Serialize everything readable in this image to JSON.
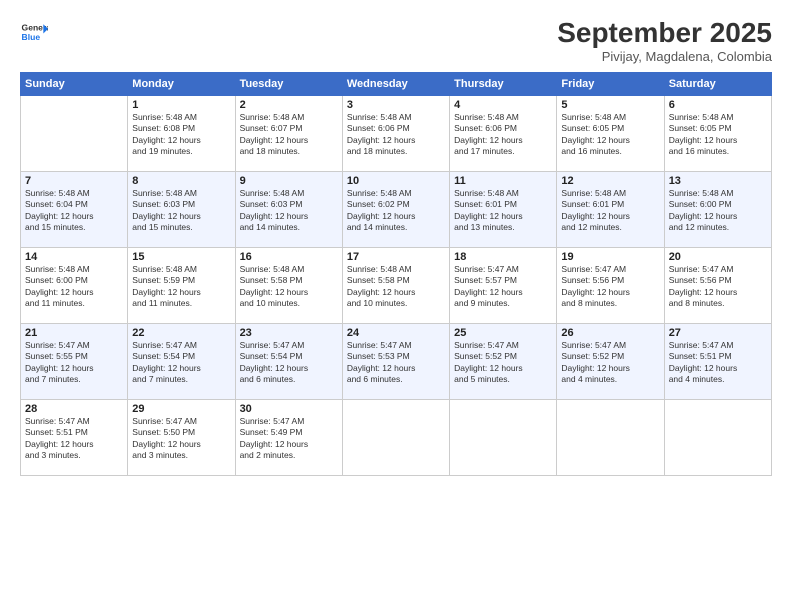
{
  "header": {
    "logo_line1": "General",
    "logo_line2": "Blue",
    "month": "September 2025",
    "location": "Pivijay, Magdalena, Colombia"
  },
  "days_of_week": [
    "Sunday",
    "Monday",
    "Tuesday",
    "Wednesday",
    "Thursday",
    "Friday",
    "Saturday"
  ],
  "weeks": [
    [
      {
        "day": "",
        "info": ""
      },
      {
        "day": "1",
        "info": "Sunrise: 5:48 AM\nSunset: 6:08 PM\nDaylight: 12 hours\nand 19 minutes."
      },
      {
        "day": "2",
        "info": "Sunrise: 5:48 AM\nSunset: 6:07 PM\nDaylight: 12 hours\nand 18 minutes."
      },
      {
        "day": "3",
        "info": "Sunrise: 5:48 AM\nSunset: 6:06 PM\nDaylight: 12 hours\nand 18 minutes."
      },
      {
        "day": "4",
        "info": "Sunrise: 5:48 AM\nSunset: 6:06 PM\nDaylight: 12 hours\nand 17 minutes."
      },
      {
        "day": "5",
        "info": "Sunrise: 5:48 AM\nSunset: 6:05 PM\nDaylight: 12 hours\nand 16 minutes."
      },
      {
        "day": "6",
        "info": "Sunrise: 5:48 AM\nSunset: 6:05 PM\nDaylight: 12 hours\nand 16 minutes."
      }
    ],
    [
      {
        "day": "7",
        "info": "Sunrise: 5:48 AM\nSunset: 6:04 PM\nDaylight: 12 hours\nand 15 minutes."
      },
      {
        "day": "8",
        "info": "Sunrise: 5:48 AM\nSunset: 6:03 PM\nDaylight: 12 hours\nand 15 minutes."
      },
      {
        "day": "9",
        "info": "Sunrise: 5:48 AM\nSunset: 6:03 PM\nDaylight: 12 hours\nand 14 minutes."
      },
      {
        "day": "10",
        "info": "Sunrise: 5:48 AM\nSunset: 6:02 PM\nDaylight: 12 hours\nand 14 minutes."
      },
      {
        "day": "11",
        "info": "Sunrise: 5:48 AM\nSunset: 6:01 PM\nDaylight: 12 hours\nand 13 minutes."
      },
      {
        "day": "12",
        "info": "Sunrise: 5:48 AM\nSunset: 6:01 PM\nDaylight: 12 hours\nand 12 minutes."
      },
      {
        "day": "13",
        "info": "Sunrise: 5:48 AM\nSunset: 6:00 PM\nDaylight: 12 hours\nand 12 minutes."
      }
    ],
    [
      {
        "day": "14",
        "info": "Sunrise: 5:48 AM\nSunset: 6:00 PM\nDaylight: 12 hours\nand 11 minutes."
      },
      {
        "day": "15",
        "info": "Sunrise: 5:48 AM\nSunset: 5:59 PM\nDaylight: 12 hours\nand 11 minutes."
      },
      {
        "day": "16",
        "info": "Sunrise: 5:48 AM\nSunset: 5:58 PM\nDaylight: 12 hours\nand 10 minutes."
      },
      {
        "day": "17",
        "info": "Sunrise: 5:48 AM\nSunset: 5:58 PM\nDaylight: 12 hours\nand 10 minutes."
      },
      {
        "day": "18",
        "info": "Sunrise: 5:47 AM\nSunset: 5:57 PM\nDaylight: 12 hours\nand 9 minutes."
      },
      {
        "day": "19",
        "info": "Sunrise: 5:47 AM\nSunset: 5:56 PM\nDaylight: 12 hours\nand 8 minutes."
      },
      {
        "day": "20",
        "info": "Sunrise: 5:47 AM\nSunset: 5:56 PM\nDaylight: 12 hours\nand 8 minutes."
      }
    ],
    [
      {
        "day": "21",
        "info": "Sunrise: 5:47 AM\nSunset: 5:55 PM\nDaylight: 12 hours\nand 7 minutes."
      },
      {
        "day": "22",
        "info": "Sunrise: 5:47 AM\nSunset: 5:54 PM\nDaylight: 12 hours\nand 7 minutes."
      },
      {
        "day": "23",
        "info": "Sunrise: 5:47 AM\nSunset: 5:54 PM\nDaylight: 12 hours\nand 6 minutes."
      },
      {
        "day": "24",
        "info": "Sunrise: 5:47 AM\nSunset: 5:53 PM\nDaylight: 12 hours\nand 6 minutes."
      },
      {
        "day": "25",
        "info": "Sunrise: 5:47 AM\nSunset: 5:52 PM\nDaylight: 12 hours\nand 5 minutes."
      },
      {
        "day": "26",
        "info": "Sunrise: 5:47 AM\nSunset: 5:52 PM\nDaylight: 12 hours\nand 4 minutes."
      },
      {
        "day": "27",
        "info": "Sunrise: 5:47 AM\nSunset: 5:51 PM\nDaylight: 12 hours\nand 4 minutes."
      }
    ],
    [
      {
        "day": "28",
        "info": "Sunrise: 5:47 AM\nSunset: 5:51 PM\nDaylight: 12 hours\nand 3 minutes."
      },
      {
        "day": "29",
        "info": "Sunrise: 5:47 AM\nSunset: 5:50 PM\nDaylight: 12 hours\nand 3 minutes."
      },
      {
        "day": "30",
        "info": "Sunrise: 5:47 AM\nSunset: 5:49 PM\nDaylight: 12 hours\nand 2 minutes."
      },
      {
        "day": "",
        "info": ""
      },
      {
        "day": "",
        "info": ""
      },
      {
        "day": "",
        "info": ""
      },
      {
        "day": "",
        "info": ""
      }
    ]
  ]
}
